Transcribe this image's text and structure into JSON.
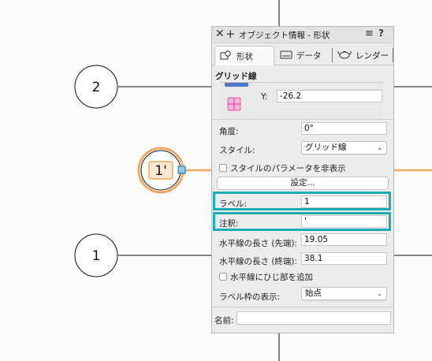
{
  "canvas": {
    "grid_bubbles": [
      {
        "label": "2"
      },
      {
        "label": "1'"
      },
      {
        "label": "1"
      }
    ],
    "highlight_color": "#f0a868"
  },
  "palette": {
    "title": "オブジェクト情報 - 形状",
    "close_icon": "close-icon",
    "add_icon": "plus-icon",
    "menu_icon": "hamburger-icon",
    "help_label": "?",
    "tabs": [
      {
        "label": "形状",
        "icon": "shape-icon"
      },
      {
        "label": "データ",
        "icon": "data-icon"
      },
      {
        "label": "レンダー",
        "icon": "teapot-icon"
      }
    ],
    "section_title": "グリッド線",
    "y_label": "Y:",
    "y_value": "-26.2",
    "angle_label": "角度:",
    "angle_value": "0°",
    "style_label": "スタイル:",
    "style_value": "グリッド線",
    "hide_style_params_label": "スタイルのパラメータを非表示",
    "settings_button": "設定...",
    "label_label": "ラベル:",
    "label_value": "1",
    "note_label": "注釈:",
    "note_value": "'",
    "hline_start_label": "水平線の長さ (先端):",
    "hline_start_value": "19.05",
    "hline_end_label": "水平線の長さ (終端):",
    "hline_end_value": "38.1",
    "add_hinge_label": "水平線にひじ部を追加",
    "frame_display_label": "ラベル枠の表示:",
    "frame_display_value": "始点",
    "name_label": "名前:",
    "name_value": "",
    "accent_color": "#1aaeb0"
  }
}
